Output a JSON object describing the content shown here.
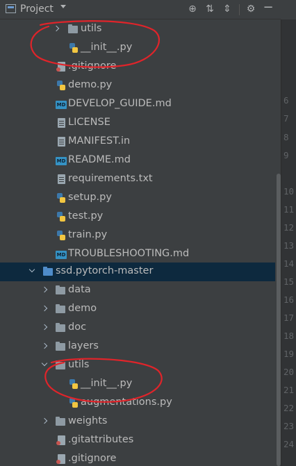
{
  "header": {
    "title": "Project",
    "icons": [
      "locate-icon",
      "expand-all-icon",
      "collapse-all-icon",
      "settings-icon",
      "hide-icon"
    ]
  },
  "tree": {
    "rows": [
      {
        "label": "utils",
        "kind": "folder",
        "expanded": false
      },
      {
        "label": "__init__.py",
        "kind": "py"
      },
      {
        "label": ".gitignore",
        "kind": "git"
      },
      {
        "label": "demo.py",
        "kind": "py"
      },
      {
        "label": "DEVELOP_GUIDE.md",
        "kind": "md"
      },
      {
        "label": "LICENSE",
        "kind": "file"
      },
      {
        "label": "MANIFEST.in",
        "kind": "file"
      },
      {
        "label": "README.md",
        "kind": "md"
      },
      {
        "label": "requirements.txt",
        "kind": "file"
      },
      {
        "label": "setup.py",
        "kind": "py"
      },
      {
        "label": "test.py",
        "kind": "py"
      },
      {
        "label": "train.py",
        "kind": "py"
      },
      {
        "label": "TROUBLESHOOTING.md",
        "kind": "md"
      },
      {
        "label": "ssd.pytorch-master",
        "kind": "module-folder",
        "expanded": true,
        "selected": true
      },
      {
        "label": "data",
        "kind": "folder",
        "expanded": false
      },
      {
        "label": "demo",
        "kind": "folder",
        "expanded": false
      },
      {
        "label": "doc",
        "kind": "folder",
        "expanded": false
      },
      {
        "label": "layers",
        "kind": "folder",
        "expanded": false
      },
      {
        "label": "utils",
        "kind": "folder",
        "expanded": true
      },
      {
        "label": "__init__.py",
        "kind": "py"
      },
      {
        "label": "augmentations.py",
        "kind": "py"
      },
      {
        "label": "weights",
        "kind": "folder",
        "expanded": false
      },
      {
        "label": ".gitattributes",
        "kind": "git"
      },
      {
        "label": ".gitignore",
        "kind": "git"
      }
    ]
  },
  "md_badge": "MD",
  "gutter": {
    "line_numbers": [
      "6",
      "7",
      "8",
      "9",
      "10",
      "11",
      "12",
      "13",
      "14",
      "15",
      "16",
      "17",
      "18",
      "19",
      "20",
      "21",
      "22",
      "23",
      "24"
    ]
  },
  "colors": {
    "panel_bg": "#3c3f41",
    "selection_bg": "#0d293e",
    "text": "#bbbbbb",
    "annotation": "#e0242a",
    "module_folder": "#4f8cc9"
  }
}
